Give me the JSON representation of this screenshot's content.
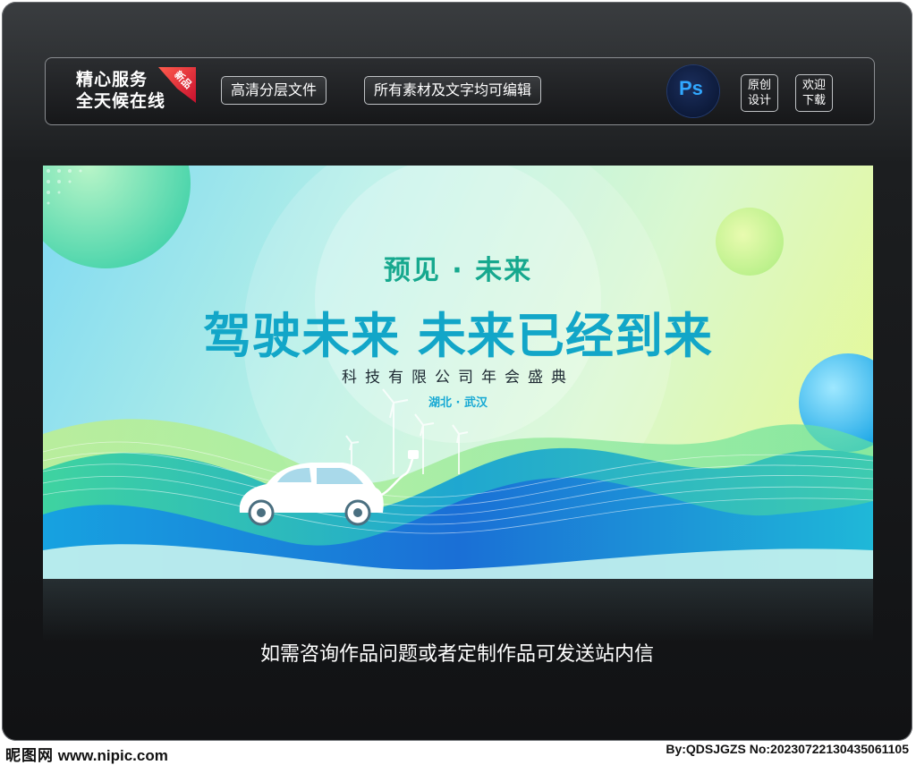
{
  "topbar": {
    "brand_line1": "精心服务",
    "brand_line2": "全天候在线",
    "badge": "新品",
    "tag1": "高清分层文件",
    "tag2": "所有素材及文字均可编辑",
    "ps_label": "Ps",
    "original_line1": "原创",
    "original_line2": "设计",
    "download_line1": "欢迎",
    "download_line2": "下载"
  },
  "poster": {
    "subtitle": "预见 · 未来",
    "title": "驾驶未来  未来已经到来",
    "company": "科技有限公司年会盛典",
    "location": "湖北 · 武汉"
  },
  "notice": "如需咨询作品问题或者定制作品可发送站内信",
  "footer": {
    "site_logo": "昵图网",
    "site_url": "www.nipic.com",
    "credit": "By:QDSJGZS No:20230722130435061105"
  },
  "colors": {
    "frame_dark": "#111214",
    "accent_teal": "#12a6c8",
    "accent_green": "#16a88e",
    "badge_red": "#c8102e",
    "ps_blue": "#31a8ff"
  }
}
